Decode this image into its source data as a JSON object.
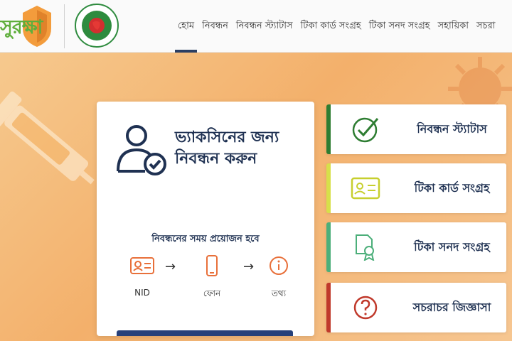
{
  "brand": {
    "name": "সুরক্ষা"
  },
  "seal": {
    "text_top": "গণপ্রজাতন্ত্রী বাংলাদেশ",
    "text_bottom": "সরকার"
  },
  "nav": {
    "items": [
      {
        "label": "হোম",
        "active": true
      },
      {
        "label": "নিবন্ধন"
      },
      {
        "label": "নিবন্ধন স্ট্যাটাস"
      },
      {
        "label": "টিকা কার্ড সংগ্রহ"
      },
      {
        "label": "টিকা সনদ সংগ্রহ"
      },
      {
        "label": "সহায়িকা"
      },
      {
        "label": "সচরা"
      }
    ]
  },
  "main": {
    "title": "ভ্যাকসিনের জন্য নিবন্ধন করুন",
    "requirements_title": "নিবন্ধনের সময় প্রয়োজন হবে",
    "requirements": [
      {
        "label": "NID",
        "icon": "id-card-icon"
      },
      {
        "label": "ফোন",
        "icon": "phone-icon"
      },
      {
        "label": "তথ্য",
        "icon": "info-icon"
      }
    ]
  },
  "tiles": [
    {
      "label": "নিবন্ধন স্ট্যাটাস",
      "icon": "check-circle-icon",
      "accent": "#2e7d32"
    },
    {
      "label": "টিকা কার্ড সংগ্রহ",
      "icon": "vaccine-card-icon",
      "accent": "#d7e04a"
    },
    {
      "label": "টিকা সনদ সংগ্রহ",
      "icon": "certificate-icon",
      "accent": "#4caf7a"
    },
    {
      "label": "সচরাচর জিজ্ঞাসা",
      "icon": "question-icon",
      "accent": "#c0392b"
    }
  ],
  "colors": {
    "brand_green": "#5fae3c",
    "navy": "#1f3152",
    "background": "#f4b978"
  }
}
